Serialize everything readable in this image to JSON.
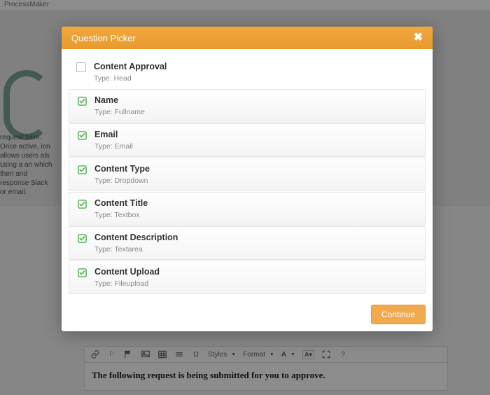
{
  "bg_header": "ProcessMaker",
  "bg_desc": "request form. Once active, ion allows users als using a an which then and response Slack or email.",
  "modal": {
    "title": "Question Picker",
    "items": [
      {
        "title": "Content Approval",
        "type_label": "Type: Head",
        "checked": false
      },
      {
        "title": "Name",
        "type_label": "Type: Fullname",
        "checked": true
      },
      {
        "title": "Email",
        "type_label": "Type: Email",
        "checked": true
      },
      {
        "title": "Content Type",
        "type_label": "Type: Dropdown",
        "checked": true
      },
      {
        "title": "Content Title",
        "type_label": "Type: Textbox",
        "checked": true
      },
      {
        "title": "Content Description",
        "type_label": "Type: Textarea",
        "checked": true
      },
      {
        "title": "Content Upload",
        "type_label": "Type: Fileupload",
        "checked": true
      }
    ],
    "continue_label": "Continue"
  },
  "toolbar": {
    "styles_label": "Styles",
    "format_label": "Format",
    "a_label": "A"
  },
  "editor_text": "The following request is being submitted for you to approve."
}
